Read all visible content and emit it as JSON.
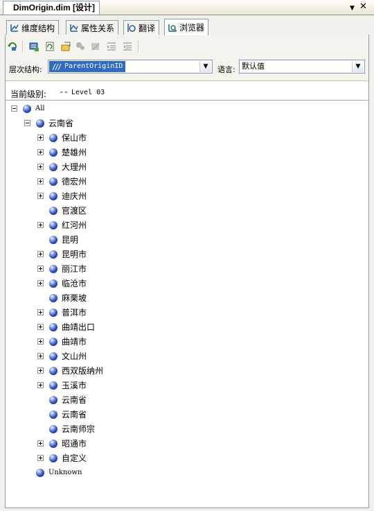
{
  "document_tab": {
    "title": "DimOrigin.dim [设计]"
  },
  "window_controls": {
    "dropdown": "▼",
    "close": "✕"
  },
  "designer_tabs": [
    {
      "label": "维度结构",
      "icon": "dimension-structure-icon"
    },
    {
      "label": "属性关系",
      "icon": "attribute-relationships-icon"
    },
    {
      "label": "翻译",
      "icon": "translations-icon"
    },
    {
      "label": "浏览器",
      "icon": "browser-icon",
      "active": true
    }
  ],
  "filters": {
    "hierarchy_label": "层次结构:",
    "hierarchy_value": "ParentOriginID",
    "language_label": "语言:",
    "language_value": "默认值"
  },
  "level": {
    "label": "当前级别:",
    "dots": "⁃⁃",
    "value": "Level 03"
  },
  "tree": [
    {
      "label": "All",
      "depth": 0,
      "expander": "minus"
    },
    {
      "label": "云南省",
      "depth": 1,
      "expander": "minus"
    },
    {
      "label": "保山市",
      "depth": 2,
      "expander": "plus"
    },
    {
      "label": "楚雄州",
      "depth": 2,
      "expander": "plus"
    },
    {
      "label": "大理州",
      "depth": 2,
      "expander": "plus"
    },
    {
      "label": "德宏州",
      "depth": 2,
      "expander": "plus"
    },
    {
      "label": "迪庆州",
      "depth": 2,
      "expander": "plus"
    },
    {
      "label": "官渡区",
      "depth": 2,
      "expander": "none"
    },
    {
      "label": "红河州",
      "depth": 2,
      "expander": "plus"
    },
    {
      "label": "昆明",
      "depth": 2,
      "expander": "none"
    },
    {
      "label": "昆明市",
      "depth": 2,
      "expander": "plus"
    },
    {
      "label": "丽江市",
      "depth": 2,
      "expander": "plus"
    },
    {
      "label": "临沧市",
      "depth": 2,
      "expander": "plus"
    },
    {
      "label": "麻栗坡",
      "depth": 2,
      "expander": "none"
    },
    {
      "label": "普洱市",
      "depth": 2,
      "expander": "plus"
    },
    {
      "label": "曲靖出口",
      "depth": 2,
      "expander": "plus"
    },
    {
      "label": "曲靖市",
      "depth": 2,
      "expander": "plus"
    },
    {
      "label": "文山州",
      "depth": 2,
      "expander": "plus"
    },
    {
      "label": "西双版纳州",
      "depth": 2,
      "expander": "plus"
    },
    {
      "label": "玉溪市",
      "depth": 2,
      "expander": "plus"
    },
    {
      "label": "云南省",
      "depth": 2,
      "expander": "none"
    },
    {
      "label": "云南省",
      "depth": 2,
      "expander": "none"
    },
    {
      "label": "云南师宗",
      "depth": 2,
      "expander": "none"
    },
    {
      "label": "昭通市",
      "depth": 2,
      "expander": "plus"
    },
    {
      "label": "自定义",
      "depth": 2,
      "expander": "plus"
    },
    {
      "label": "Unknown",
      "depth": 1,
      "expander": "none"
    }
  ],
  "colors": {
    "selection": "#316ac5",
    "member_ball": "#3450c8"
  }
}
